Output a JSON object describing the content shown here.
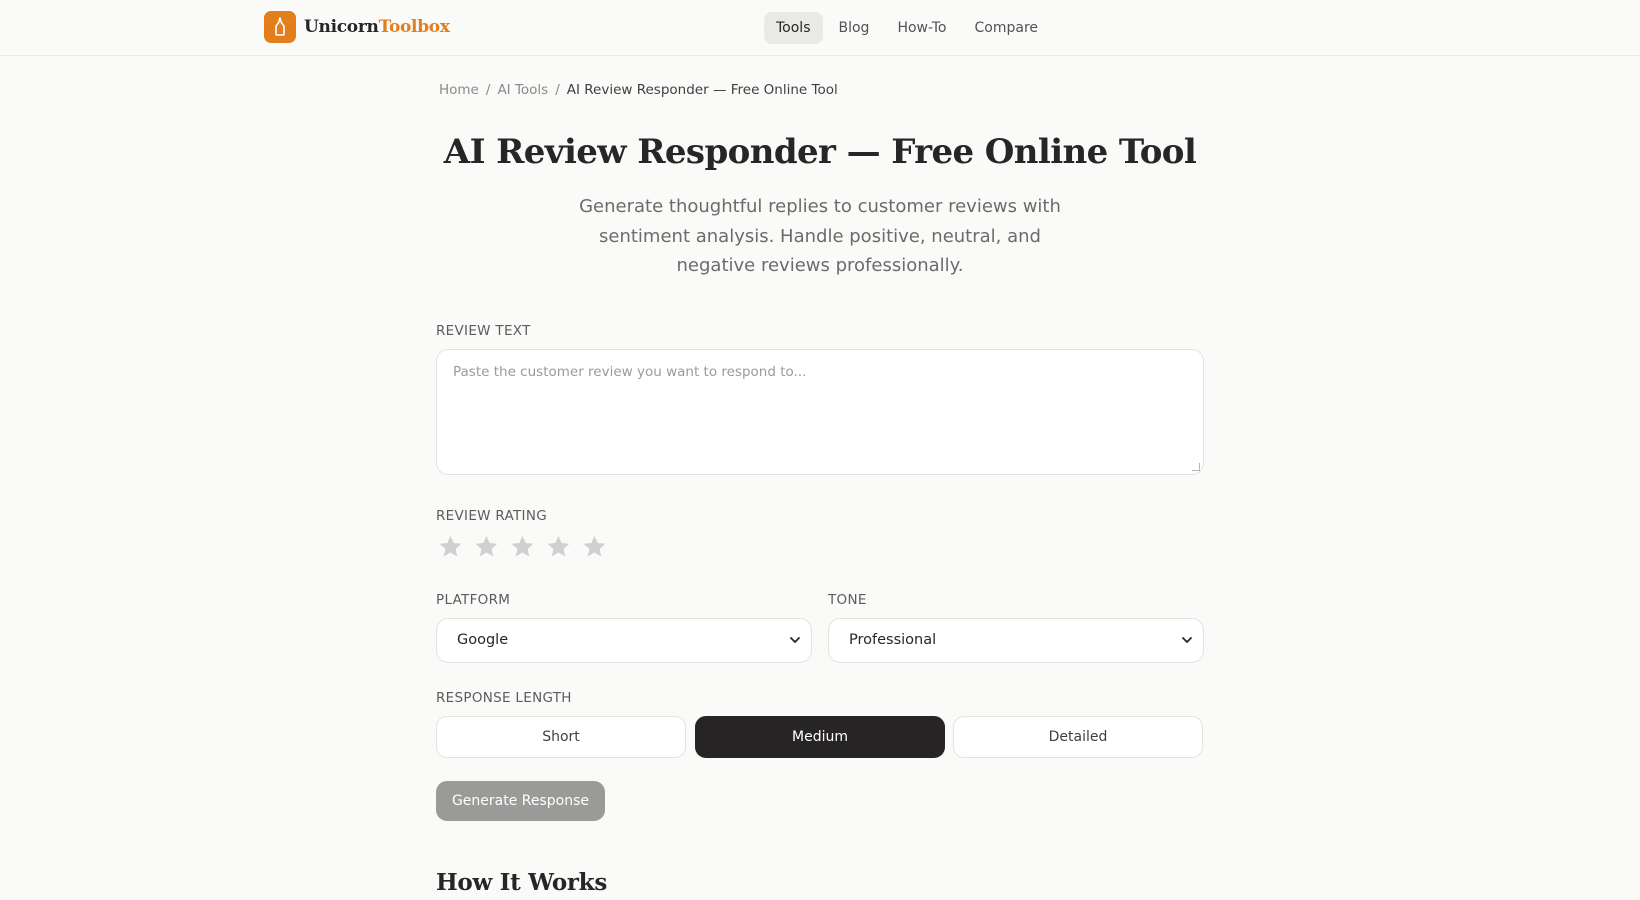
{
  "header": {
    "logo_part1": "Unicorn",
    "logo_part2": "Toolbox",
    "nav": [
      {
        "label": "Tools",
        "active": true
      },
      {
        "label": "Blog",
        "active": false
      },
      {
        "label": "How-To",
        "active": false
      },
      {
        "label": "Compare",
        "active": false
      }
    ]
  },
  "breadcrumb": {
    "home": "Home",
    "sep": "/",
    "section": "AI Tools",
    "current": "AI Review Responder — Free Online Tool"
  },
  "page": {
    "title": "AI Review Responder — Free Online Tool",
    "subtitle": "Generate thoughtful replies to customer reviews with sentiment analysis. Handle positive, neutral, and negative reviews professionally."
  },
  "form": {
    "review_text_label": "REVIEW TEXT",
    "review_text_placeholder": "Paste the customer review you want to respond to...",
    "review_text_value": "",
    "rating_label": "REVIEW RATING",
    "rating_value": 0,
    "rating_max": 5,
    "platform_label": "PLATFORM",
    "platform_value": "Google",
    "tone_label": "TONE",
    "tone_value": "Professional",
    "length_label": "RESPONSE LENGTH",
    "length_options": [
      "Short",
      "Medium",
      "Detailed"
    ],
    "length_selected": "Medium",
    "generate_label": "Generate Response"
  },
  "sections": {
    "how_it_works": "How It Works"
  },
  "colors": {
    "accent": "#e27e1c",
    "selected_segment": "#262424",
    "disabled_button": "#9a9a98",
    "star_empty": "#d0d0d0"
  }
}
